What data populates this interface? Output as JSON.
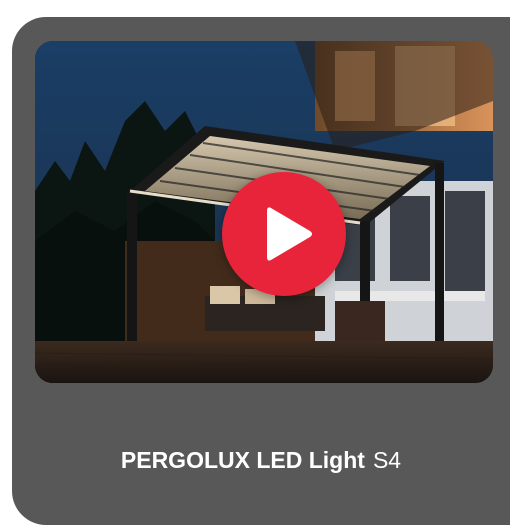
{
  "card": {
    "title_bold": "PERGOLUX LED Light",
    "title_model": "S4",
    "background_color": "#585858"
  },
  "video": {
    "play_button_color": "#e8243a",
    "play_icon": "play-icon",
    "scene_description_icon": "video-thumbnail"
  }
}
